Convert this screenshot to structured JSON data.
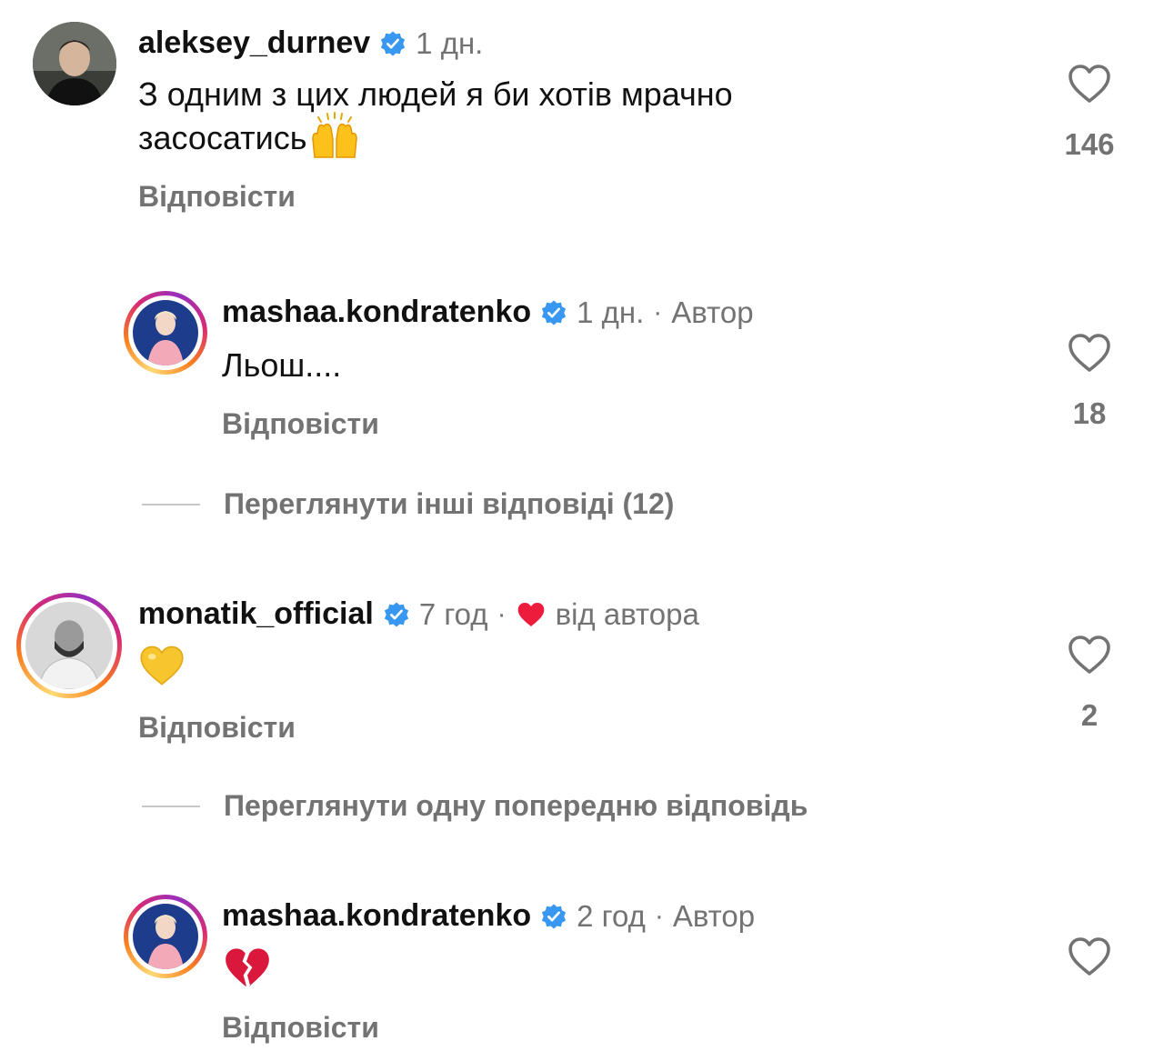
{
  "comments": [
    {
      "username": "aleksey_durnev",
      "time": "1 дн.",
      "text_line1": "З одним з цих людей я би хотів мрачно",
      "text_line2": "засосатись",
      "reply_label": "Відповісти",
      "likes": "146"
    },
    {
      "username": "mashaa.kondratenko",
      "time": "1 дн.",
      "separator": "·",
      "author_tag": "Автор",
      "text": "Льош....",
      "reply_label": "Відповісти",
      "likes": "18"
    },
    {
      "username": "monatik_official",
      "time": "7 год",
      "separator": "·",
      "liked_by_author": "від автора",
      "reply_label": "Відповісти",
      "likes": "2"
    },
    {
      "username": "mashaa.kondratenko",
      "time": "2 год",
      "separator": "·",
      "author_tag": "Автор",
      "reply_label": "Відповісти"
    }
  ],
  "view_more_1": "Переглянути інші відповіді (12)",
  "view_more_2": "Переглянути одну попередню відповідь",
  "colors": {
    "verified": "#3897f0",
    "muted": "#737373",
    "heart_red": "#ed1c3c",
    "yellow_heart": "#f7c52d"
  }
}
